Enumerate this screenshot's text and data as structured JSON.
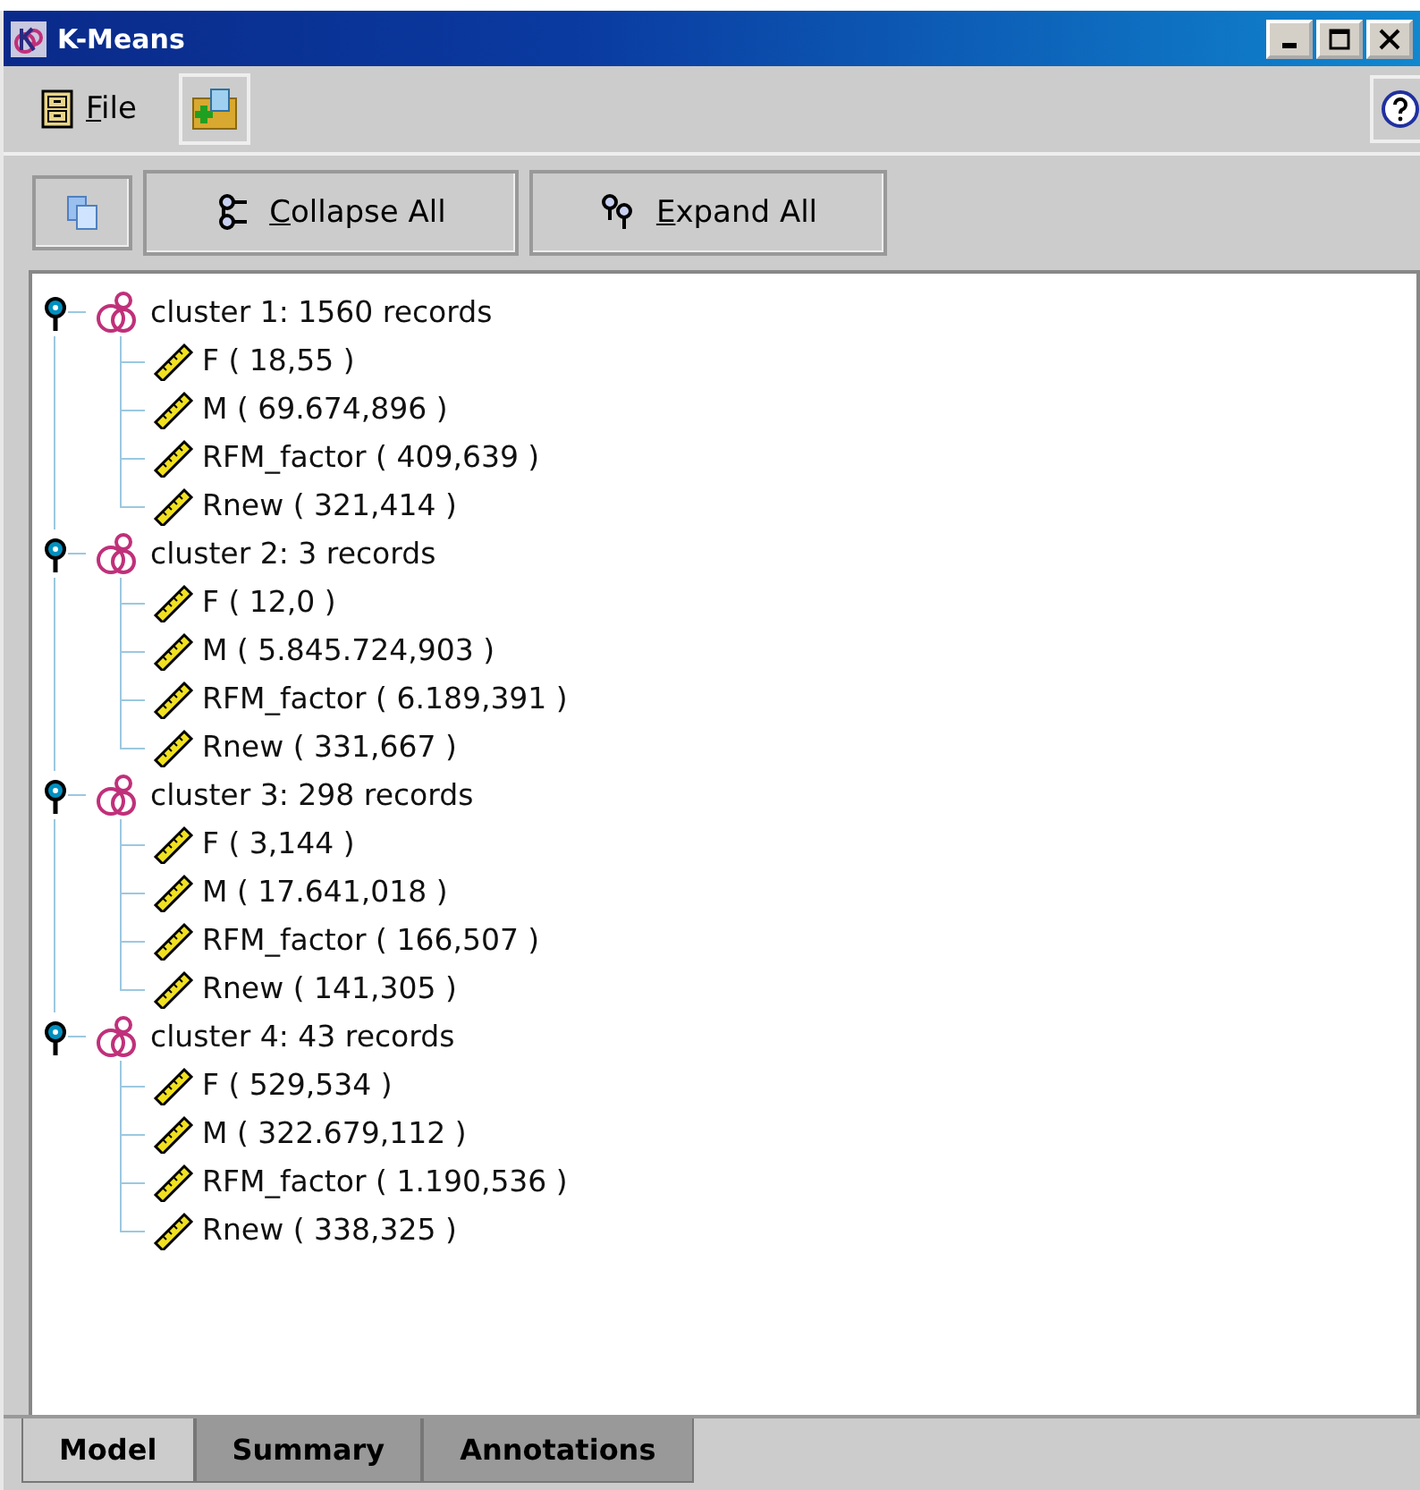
{
  "window": {
    "title": "K-Means"
  },
  "menu": [
    {
      "label": "File"
    }
  ],
  "toolbar": [
    {
      "label": "Collapse All",
      "kind": "collapse"
    },
    {
      "label": "Expand All",
      "kind": "expand"
    }
  ],
  "tree": [
    {
      "label": "cluster 1: 1560 records",
      "expanded": true,
      "children": [
        {
          "label": "F ( 18,55 )"
        },
        {
          "label": "M ( 69.674,896 )"
        },
        {
          "label": "RFM_factor ( 409,639 )"
        },
        {
          "label": "Rnew ( 321,414 )"
        }
      ]
    },
    {
      "label": "cluster 2: 3 records",
      "expanded": true,
      "children": [
        {
          "label": "F ( 12,0 )"
        },
        {
          "label": "M ( 5.845.724,903 )"
        },
        {
          "label": "RFM_factor ( 6.189,391 )"
        },
        {
          "label": "Rnew ( 331,667 )"
        }
      ]
    },
    {
      "label": "cluster 3: 298 records",
      "expanded": true,
      "children": [
        {
          "label": "F ( 3,144 )"
        },
        {
          "label": "M ( 17.641,018 )"
        },
        {
          "label": "RFM_factor ( 166,507 )"
        },
        {
          "label": "Rnew ( 141,305 )"
        }
      ]
    },
    {
      "label": "cluster 4: 43 records",
      "expanded": true,
      "children": [
        {
          "label": "F ( 529,534 )"
        },
        {
          "label": "M ( 322.679,112 )"
        },
        {
          "label": "RFM_factor ( 1.190,536 )"
        },
        {
          "label": "Rnew ( 338,325 )"
        }
      ]
    }
  ],
  "tabs": [
    {
      "label": "Model",
      "selected": true
    },
    {
      "label": "Summary",
      "selected": false
    },
    {
      "label": "Annotations",
      "selected": false
    }
  ]
}
